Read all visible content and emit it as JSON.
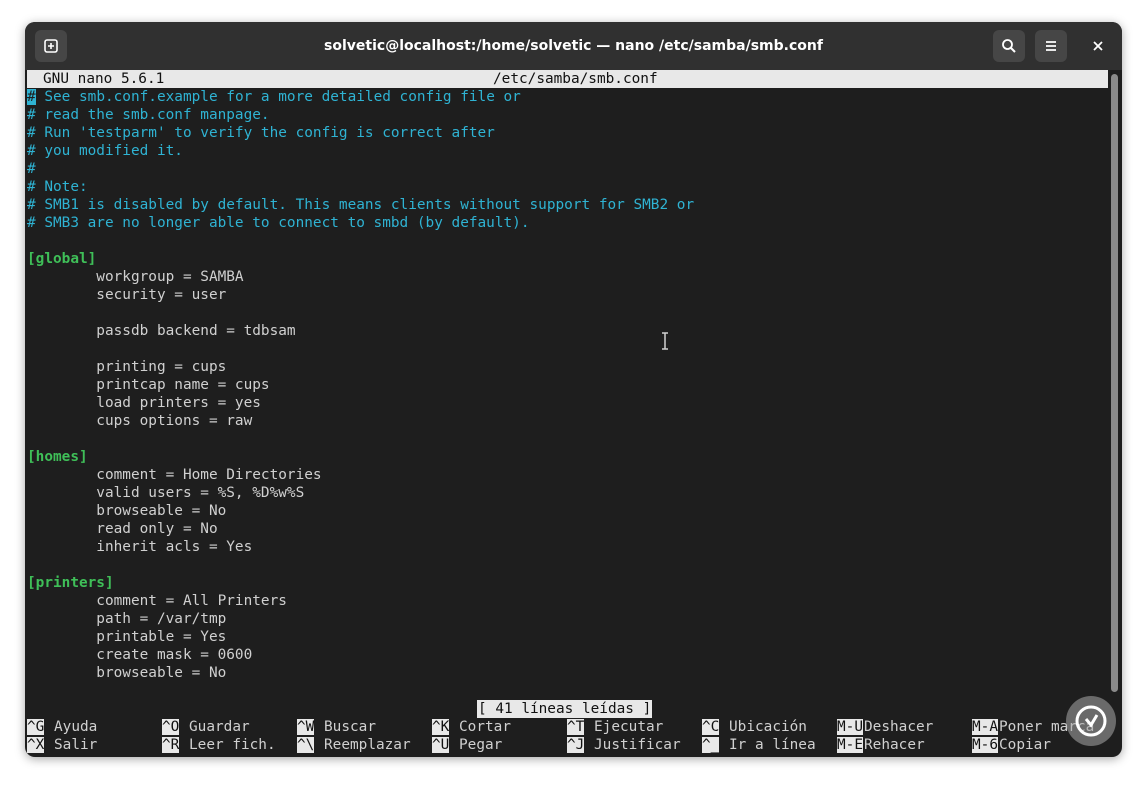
{
  "window": {
    "title": "solvetic@localhost:/home/solvetic — nano /etc/samba/smb.conf"
  },
  "icons": {
    "new_tab": "new-tab-icon",
    "search": "search-icon",
    "menu": "hamburger-menu-icon",
    "close": "close-icon"
  },
  "nano": {
    "version_label": "GNU nano 5.6.1",
    "file_path": "/etc/samba/smb.conf",
    "lines": [
      {
        "type": "cursor-comment",
        "cursor": "#",
        "text": " See smb.conf.example for a more detailed config file or"
      },
      {
        "type": "comment",
        "text": "# read the smb.conf manpage."
      },
      {
        "type": "comment",
        "text": "# Run 'testparm' to verify the config is correct after"
      },
      {
        "type": "comment",
        "text": "# you modified it."
      },
      {
        "type": "comment",
        "text": "#"
      },
      {
        "type": "comment",
        "text": "# Note:"
      },
      {
        "type": "comment",
        "text": "# SMB1 is disabled by default. This means clients without support for SMB2 or"
      },
      {
        "type": "comment",
        "text": "# SMB3 are no longer able to connect to smbd (by default)."
      },
      {
        "type": "blank",
        "text": ""
      },
      {
        "type": "section",
        "text": "[global]"
      },
      {
        "type": "normal",
        "text": "        workgroup = SAMBA"
      },
      {
        "type": "normal",
        "text": "        security = user"
      },
      {
        "type": "blank",
        "text": ""
      },
      {
        "type": "normal",
        "text": "        passdb backend = tdbsam"
      },
      {
        "type": "blank",
        "text": ""
      },
      {
        "type": "normal",
        "text": "        printing = cups"
      },
      {
        "type": "normal",
        "text": "        printcap name = cups"
      },
      {
        "type": "normal",
        "text": "        load printers = yes"
      },
      {
        "type": "normal",
        "text": "        cups options = raw"
      },
      {
        "type": "blank",
        "text": ""
      },
      {
        "type": "section",
        "text": "[homes]"
      },
      {
        "type": "normal",
        "text": "        comment = Home Directories"
      },
      {
        "type": "normal",
        "text": "        valid users = %S, %D%w%S"
      },
      {
        "type": "normal",
        "text": "        browseable = No"
      },
      {
        "type": "normal",
        "text": "        read only = No"
      },
      {
        "type": "normal",
        "text": "        inherit acls = Yes"
      },
      {
        "type": "blank",
        "text": ""
      },
      {
        "type": "section",
        "text": "[printers]"
      },
      {
        "type": "normal",
        "text": "        comment = All Printers"
      },
      {
        "type": "normal",
        "text": "        path = /var/tmp"
      },
      {
        "type": "normal",
        "text": "        printable = Yes"
      },
      {
        "type": "normal",
        "text": "        create mask = 0600"
      },
      {
        "type": "normal",
        "text": "        browseable = No"
      }
    ],
    "status_message": "[ 41 líneas leídas ]",
    "shortcuts_row1": [
      {
        "key": "^G",
        "label": "Ayuda"
      },
      {
        "key": "^O",
        "label": "Guardar"
      },
      {
        "key": "^W",
        "label": "Buscar"
      },
      {
        "key": "^K",
        "label": "Cortar"
      },
      {
        "key": "^T",
        "label": "Ejecutar"
      },
      {
        "key": "^C",
        "label": "Ubicación"
      },
      {
        "key": "M-U",
        "label": "Deshacer"
      },
      {
        "key": "M-A",
        "label": "Poner marca"
      }
    ],
    "shortcuts_row2": [
      {
        "key": "^X",
        "label": "Salir"
      },
      {
        "key": "^R",
        "label": "Leer fich."
      },
      {
        "key": "^\\",
        "label": "Reemplazar"
      },
      {
        "key": "^U",
        "label": "Pegar"
      },
      {
        "key": "^J",
        "label": "Justificar"
      },
      {
        "key": "^_",
        "label": "Ir a línea"
      },
      {
        "key": "M-E",
        "label": "Rehacer"
      },
      {
        "key": "M-6",
        "label": "Copiar"
      }
    ]
  },
  "colors": {
    "comment": "#2fb3d3",
    "section": "#3fbf58",
    "background": "#1e1e1e",
    "titlebar": "#303030"
  }
}
